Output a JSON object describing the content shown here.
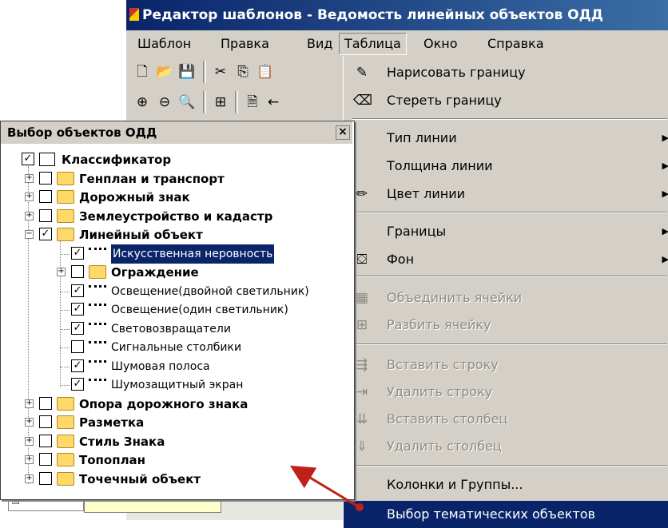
{
  "window": {
    "title": "Редактор шаблонов - Ведомость линейных объектов ОДД"
  },
  "menu_bar": [
    {
      "label": "Шаблон"
    },
    {
      "label": "Правка"
    },
    {
      "label": "Вид"
    },
    {
      "label": "Таблица",
      "open": true
    },
    {
      "label": "Окно"
    },
    {
      "label": "Справка"
    }
  ],
  "toolbar": {
    "row1": [
      "new-file-icon",
      "open-folder-icon",
      "save-icon",
      "cut-icon",
      "copy-icon",
      "paste-icon"
    ],
    "row2": [
      "zoom-in-icon",
      "zoom-out-icon",
      "zoom-fit-icon",
      "table-icon",
      "preview-icon",
      "back-arrow-icon"
    ]
  },
  "dropdown": {
    "items": [
      {
        "label": "Нарисовать границу",
        "icon": "pencil-icon",
        "enabled": true
      },
      {
        "label": "Стереть границу",
        "icon": "eraser-icon",
        "enabled": true
      },
      {
        "label": "Тип линии",
        "icon": "",
        "enabled": true,
        "submenu": true
      },
      {
        "label": "Толщина линии",
        "icon": "",
        "enabled": true,
        "submenu": true
      },
      {
        "label": "Цвет линии",
        "icon": "line-color-icon",
        "enabled": true,
        "submenu": true
      },
      {
        "label": "Границы",
        "icon": "",
        "enabled": true,
        "submenu": true
      },
      {
        "label": "Фон",
        "icon": "fill-bucket-icon",
        "enabled": true,
        "submenu": true
      },
      {
        "label": "Объединить ячейки",
        "icon": "merge-cells-icon",
        "enabled": false
      },
      {
        "label": "Разбить ячейку",
        "icon": "split-cell-icon",
        "enabled": false
      },
      {
        "label": "Вставить строку",
        "icon": "insert-row-icon",
        "enabled": false
      },
      {
        "label": "Удалить строку",
        "icon": "delete-row-icon",
        "enabled": false
      },
      {
        "label": "Вставить столбец",
        "icon": "insert-column-icon",
        "enabled": false
      },
      {
        "label": "Удалить столбец",
        "icon": "delete-column-icon",
        "enabled": false
      },
      {
        "label": "Колонки и Группы...",
        "icon": "",
        "enabled": true
      },
      {
        "label": "Выбор тематических объектов",
        "icon": "",
        "enabled": true,
        "highlighted": true
      }
    ],
    "highlight_color": "#0a246a"
  },
  "panel": {
    "title": "Выбор объектов ОДД",
    "close_label": "×",
    "tree": [
      {
        "label": "Классификатор",
        "checked": true,
        "level": 0,
        "icon": "book-icon",
        "expander": ""
      },
      {
        "label": "Генплан и транспорт",
        "checked": false,
        "level": 1,
        "icon": "folder-icon",
        "expander": "+"
      },
      {
        "label": "Дорожный знак",
        "checked": false,
        "level": 1,
        "icon": "folder-icon",
        "expander": "+"
      },
      {
        "label": "Землеустройство и кадастр",
        "checked": false,
        "level": 1,
        "icon": "folder-icon",
        "expander": "+"
      },
      {
        "label": "Линейный объект",
        "checked": true,
        "level": 1,
        "icon": "folder-icon",
        "expander": "−"
      },
      {
        "label": "Искусственная неровность",
        "checked": true,
        "level": 2,
        "icon": "line-icon",
        "expander": "",
        "selected": true
      },
      {
        "label": "Ограждение",
        "checked": false,
        "level": 2,
        "icon": "folder-icon",
        "expander": "+"
      },
      {
        "label": "Освещение(двойной светильник)",
        "checked": true,
        "level": 2,
        "icon": "line-icon",
        "expander": ""
      },
      {
        "label": "Освещение(один светильник)",
        "checked": true,
        "level": 2,
        "icon": "line-icon",
        "expander": ""
      },
      {
        "label": "Световозвращатели",
        "checked": true,
        "level": 2,
        "icon": "line-icon",
        "expander": ""
      },
      {
        "label": "Сигнальные столбики",
        "checked": false,
        "level": 2,
        "icon": "line-icon",
        "expander": ""
      },
      {
        "label": "Шумовая полоса",
        "checked": true,
        "level": 2,
        "icon": "line-icon",
        "expander": ""
      },
      {
        "label": "Шумозащитный экран",
        "checked": true,
        "level": 2,
        "icon": "line-icon",
        "expander": ""
      },
      {
        "label": "Опора дорожного знака",
        "checked": false,
        "level": 1,
        "icon": "folder-icon",
        "expander": "+"
      },
      {
        "label": "Разметка",
        "checked": false,
        "level": 1,
        "icon": "folder-icon",
        "expander": "+"
      },
      {
        "label": "Стиль Знака",
        "checked": false,
        "level": 1,
        "icon": "folder-icon",
        "expander": "+"
      },
      {
        "label": "Топоплан",
        "checked": false,
        "level": 1,
        "icon": "folder-icon",
        "expander": "+"
      },
      {
        "label": "Точечный объект",
        "checked": false,
        "level": 1,
        "icon": "folder-icon",
        "expander": "+"
      }
    ]
  },
  "annotation": {
    "arrow_color": "#c0201a"
  }
}
